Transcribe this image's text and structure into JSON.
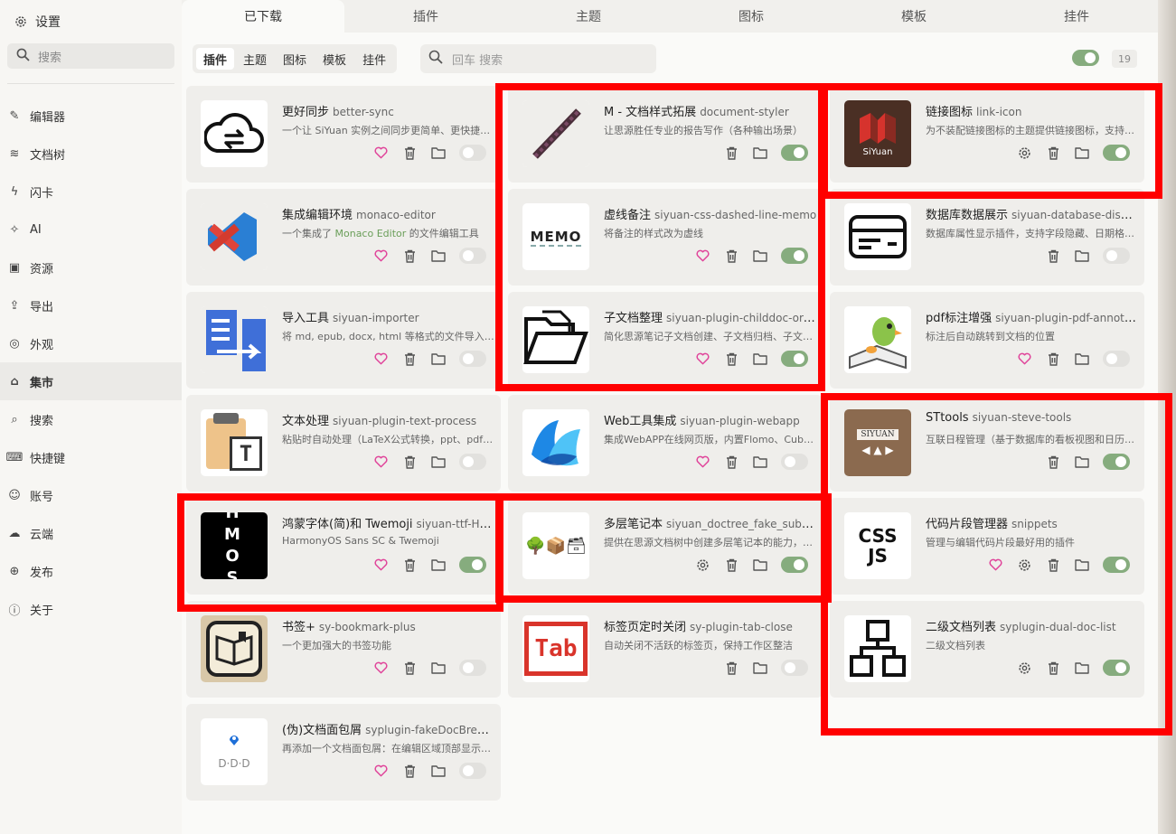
{
  "sidebar": {
    "title": "设置",
    "search_placeholder": "搜索",
    "items": [
      {
        "label": "编辑器",
        "icon": "pencil-icon",
        "glyph": "✎"
      },
      {
        "label": "文档树",
        "icon": "layers-icon",
        "glyph": "≋"
      },
      {
        "label": "闪卡",
        "icon": "flash-icon",
        "glyph": "ϟ"
      },
      {
        "label": "AI",
        "icon": "sparkle-icon",
        "glyph": "✧"
      },
      {
        "label": "资源",
        "icon": "image-icon",
        "glyph": "▣"
      },
      {
        "label": "导出",
        "icon": "export-icon",
        "glyph": "⇪"
      },
      {
        "label": "外观",
        "icon": "palette-icon",
        "glyph": "◎"
      },
      {
        "label": "集市",
        "icon": "store-icon",
        "glyph": "⌂",
        "active": true
      },
      {
        "label": "搜索",
        "icon": "search-icon",
        "glyph": "⌕"
      },
      {
        "label": "快捷键",
        "icon": "keyboard-icon",
        "glyph": "⌨"
      },
      {
        "label": "账号",
        "icon": "account-icon",
        "glyph": "☺"
      },
      {
        "label": "云端",
        "icon": "cloud-icon",
        "glyph": "☁"
      },
      {
        "label": "发布",
        "icon": "globe-icon",
        "glyph": "⊕"
      },
      {
        "label": "关于",
        "icon": "info-icon",
        "glyph": "ⓘ"
      }
    ]
  },
  "top_tabs": [
    "已下载",
    "插件",
    "主题",
    "图标",
    "模板",
    "挂件"
  ],
  "sub_tabs": [
    "插件",
    "主题",
    "图标",
    "模板",
    "挂件"
  ],
  "search_placeholder": "回车 搜索",
  "count": "19",
  "colors": {
    "accent_green": "#86ac7e",
    "heart": "#e0449a",
    "highlight": "#ff0000"
  },
  "plugins": [
    {
      "title": "更好同步",
      "pkg": "better-sync",
      "desc": "一个让 SiYuan 实例之间同步更简单、更快捷的插件",
      "icon": "cloud-sync-icon",
      "heart": true,
      "settings": false,
      "enabled": false
    },
    {
      "title": "M - 文档样式拓展",
      "pkg": "document-styler",
      "desc": "让思源胜任专业的报告写作（各种输出场景）",
      "icon": "pixel-sword-icon",
      "heart": false,
      "settings": false,
      "enabled": true
    },
    {
      "title": "链接图标",
      "pkg": "link-icon",
      "desc": "为不装配链接图标的主题提供链接图标，支持自定义",
      "icon": "siyuan-logo-icon",
      "icon_text": "SiYuan",
      "heart": false,
      "settings": true,
      "enabled": true
    },
    {
      "title": "集成编辑环境",
      "pkg": "monaco-editor",
      "desc_pre": "一个集成了 ",
      "desc_hl": "Monaco Editor",
      "desc_post": " 的文件编辑工具",
      "icon": "vscode-icon",
      "heart": true,
      "settings": false,
      "enabled": false
    },
    {
      "title": "虚线备注",
      "pkg": "siyuan-css-dashed-line-memo",
      "desc": "将备注的样式改为虚线",
      "icon": "memo-icon",
      "icon_text": "MEMO",
      "heart": true,
      "settings": false,
      "enabled": true
    },
    {
      "title": "数据库数据展示",
      "pkg": "siyuan-database-display",
      "desc": "数据库属性显示插件，支持字段隐藏、日期格式化等",
      "icon": "card-icon",
      "heart": false,
      "settings": false,
      "enabled": false
    },
    {
      "title": "导入工具",
      "pkg": "siyuan-importer",
      "desc": "将 md, epub, docx, html 等格式的文件导入到思源",
      "icon": "import-icon",
      "heart": true,
      "settings": false,
      "enabled": false
    },
    {
      "title": "子文档整理",
      "pkg": "siyuan-plugin-childdoc-organizer",
      "desc": "简化思源笔记子文档创建、子文档归档、子文档排序",
      "icon": "folder-open-icon",
      "heart": true,
      "settings": false,
      "enabled": true
    },
    {
      "title": "pdf标注增强",
      "pkg": "siyuan-plugin-pdf-annotation",
      "desc": "标注后自动跳转到文档的位置",
      "icon": "parrot-book-icon",
      "heart": true,
      "settings": false,
      "enabled": false
    },
    {
      "title": "文本处理",
      "pkg": "siyuan-plugin-text-process",
      "desc": "粘贴时自动处理（LaTeX公式转换，ppt、pdf复制去除换行）",
      "icon": "clipboard-text-icon",
      "icon_text": "T",
      "heart": true,
      "settings": false,
      "enabled": false
    },
    {
      "title": "Web工具集成",
      "pkg": "siyuan-plugin-webapp",
      "desc": "集成WebAPP在线网页版，内置Flomo、Cubox等",
      "icon": "blue-petal-icon",
      "heart": true,
      "settings": false,
      "enabled": false
    },
    {
      "title": "STtools",
      "pkg": "siyuan-steve-tools",
      "desc": "互联日程管理（基于数据库的看板视图和日历视图）",
      "icon": "siyuan-folder-icon",
      "icon_text": "SIYUAN",
      "heart": false,
      "settings": false,
      "enabled": true
    },
    {
      "title": "鸿蒙字体(简)和 Twemoji",
      "pkg": "siyuan-ttf-HarmonyOS_Sans_SC-and-Twemoji",
      "desc": "HarmonyOS Sans SC & Twemoji",
      "icon": "hmos-icon",
      "icon_text": "H M O S",
      "heart": true,
      "settings": false,
      "enabled": true
    },
    {
      "title": "多层笔记本",
      "pkg": "siyuan_doctree_fake_subfolder",
      "desc": "提供在思源文档树中创建多层笔记本的能力，支持拖拽",
      "icon": "tree-boxes-icon",
      "icon_text": "🌳📦🗃",
      "heart": false,
      "settings": true,
      "enabled": true
    },
    {
      "title": "代码片段管理器",
      "pkg": "snippets",
      "desc": "管理与编辑代码片段最好用的插件",
      "icon": "css-js-icon",
      "icon_text": "CSS JS",
      "heart": true,
      "settings": true,
      "enabled": true
    },
    {
      "title": "书签+",
      "pkg": "sy-bookmark-plus",
      "desc": "一个更加强大的书签功能",
      "icon": "bookmark-book-icon",
      "heart": true,
      "settings": false,
      "enabled": false
    },
    {
      "title": "标签页定时关闭",
      "pkg": "sy-plugin-tab-close",
      "desc": "自动关闭不活跃的标签页，保持工作区整洁",
      "icon": "tab-icon",
      "icon_text": "Tab",
      "heart": false,
      "settings": false,
      "enabled": false
    },
    {
      "title": "二级文档列表",
      "pkg": "syplugin-dual-doc-list",
      "desc": "二级文档列表",
      "icon": "sitemap-icon",
      "heart": false,
      "settings": true,
      "enabled": true
    },
    {
      "title": "(伪)文档面包屑",
      "pkg": "syplugin-fakeDocBreadcrumb",
      "desc": "再添加一个文档面包屑：在编辑区域顶部显示当前文档路径",
      "icon": "breadcrumb-icon",
      "icon_text": "D·D·D",
      "heart": true,
      "settings": false,
      "enabled": false
    }
  ]
}
